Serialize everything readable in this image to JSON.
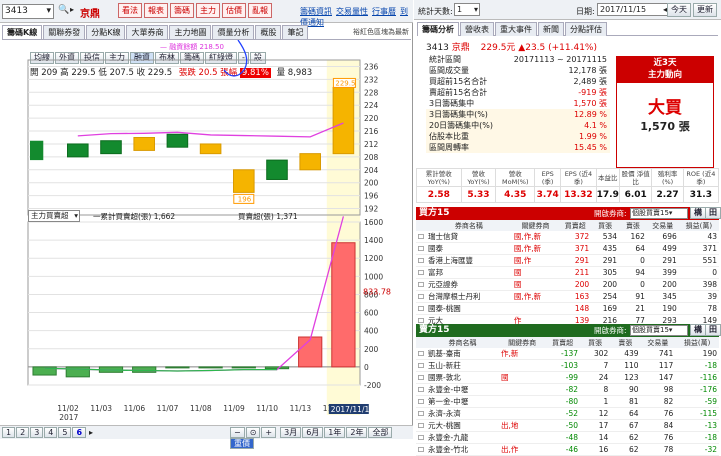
{
  "top": {
    "code": "3413",
    "name": "京鼎",
    "nav": [
      "看法",
      "報表",
      "籌碼",
      "主力",
      "估價",
      "亂報"
    ],
    "links": [
      "籌碼資訊",
      "交易量性",
      "行事曆",
      "到價通知"
    ]
  },
  "left": {
    "tabs": [
      "籌碼K線",
      "關聯券發",
      "分點K線",
      "大單券商",
      "主力地圖",
      "價量分析",
      "概股",
      "筆記"
    ],
    "right_note": "裕紅色區塊為最新",
    "subtabs": [
      "均線",
      "外資",
      "投信",
      "主力",
      "融資",
      "布林",
      "籌碼",
      "紅綠燈",
      "-",
      "設"
    ],
    "subtab_active": "融資",
    "legend": "— 融資餘額 218.50",
    "ohlc": "開 209 高 229.5 低 207.5 收 229.5",
    "chg_label": "張跌 20.5 張幅",
    "chg_pct": "9.81%",
    "vol": "量 8,983",
    "price_ticks": [
      "236",
      "232",
      "228",
      "224",
      "220",
      "216",
      "212",
      "208",
      "204",
      "200",
      "196",
      "192"
    ],
    "high_tag": "229.5",
    "low_tag": "196",
    "vol_ticks": [
      "1600",
      "1400",
      "1200",
      "1000",
      "800",
      "600",
      "400",
      "200",
      "0",
      "-200"
    ],
    "vol_current": "833.78",
    "select": "主力買賣超",
    "l1": "一累計買賣超(張) 1,662",
    "l2": "買賣超(張) 1,371",
    "dates": [
      "11/02",
      "11/03",
      "11/06",
      "11/07",
      "11/08",
      "11/09",
      "11/10",
      "11/13",
      "11/14"
    ],
    "year": "2017",
    "cur_date": "2017/11/15",
    "pages": [
      "1",
      "2",
      "3",
      "4",
      "5",
      "6"
    ],
    "zoom": [
      "3月",
      "6月",
      "1年",
      "2年",
      "全部",
      "重價"
    ],
    "candles": [
      {
        "o": 212,
        "c": 208,
        "up": false
      },
      {
        "o": 213,
        "c": 209,
        "up": false
      },
      {
        "o": 210,
        "c": 214,
        "up": true
      },
      {
        "o": 215,
        "c": 211,
        "up": false
      },
      {
        "o": 209,
        "c": 212,
        "up": true
      },
      {
        "o": 204,
        "c": 197,
        "up": true
      },
      {
        "o": 201,
        "c": 207,
        "up": false
      },
      {
        "o": 204,
        "c": 209,
        "up": true
      },
      {
        "o": 209,
        "c": 229.5,
        "up": true
      }
    ],
    "ma": [
      214.5,
      215.2,
      215.3,
      215.6,
      214.8,
      214.6,
      214.4,
      214.2,
      218.5
    ],
    "vol_bars": [
      -90,
      -110,
      -60,
      -60,
      -10,
      -10,
      -5,
      -20,
      330,
      1371
    ],
    "cum": [
      -15,
      -25,
      -35,
      -40,
      -45,
      -40,
      -30,
      -30,
      300,
      1662
    ]
  },
  "right": {
    "top_label": "統計天數:",
    "days": "1",
    "date_label": "日期:",
    "date": "2017/11/15",
    "today_btn": "今天",
    "refresh_btn": "更新",
    "tabs": [
      "籌碼分析",
      "營收表",
      "重大事件",
      "新聞",
      "分點評估"
    ],
    "title_code": "3413",
    "title_name": "京鼎",
    "title_price": "229.5元 ▲23.5 (+11.41%)",
    "stats": [
      [
        "統計區間",
        "20171113 ~ 20171115"
      ],
      [
        "區間成交量",
        "12,178 張"
      ],
      [
        "買超前15名合計",
        "2,489 張"
      ],
      [
        "賣超前15名合計",
        "-919 張"
      ],
      [
        "3日籌碼集中",
        "1,570 張"
      ],
      [
        "3日籌碼集中(%)",
        "12.89 %"
      ],
      [
        "20日籌碼集中(%)",
        "4.1 %"
      ],
      [
        "佔股本比重",
        "1.99 %"
      ],
      [
        "區間周轉率",
        "15.45 %"
      ]
    ],
    "box_red": [
      "近3天",
      "主力動向"
    ],
    "big": "大買",
    "big_val": "1,570 張",
    "fin_heads": [
      "累計營收 YoY(%)",
      "營收 YoY(%)",
      "營收 MoM(%)",
      "EPS (季)",
      "EPS (近4季)",
      "本益比",
      "股價 淨值比",
      "殖利率 (%)",
      "ROE (近4季)"
    ],
    "fin_vals": [
      "2.58",
      "5.33",
      "4.35",
      "3.74",
      "13.32",
      "17.9",
      "6.01",
      "2.27",
      "31.3"
    ],
    "buy_title": "買方15",
    "sell_title": "賣方15",
    "sel_label": "開啟券商:",
    "sel": "個股買賣15",
    "btns": [
      "構",
      "田"
    ],
    "col": [
      "券商名稱",
      "關鍵券商",
      "買賣超",
      "買張",
      "賣張",
      "交易量",
      "損益(萬)"
    ],
    "buy": [
      [
        "瑞士信貸",
        "國,作,新",
        "372",
        "534",
        "162",
        "696",
        "43"
      ],
      [
        "國泰",
        "國,作,新",
        "371",
        "435",
        "64",
        "499",
        "371"
      ],
      [
        "香港上海匯豐",
        "國,作",
        "291",
        "291",
        "0",
        "291",
        "551"
      ],
      [
        "富邦",
        "國",
        "211",
        "305",
        "94",
        "399",
        "0"
      ],
      [
        "元亞證券",
        "國",
        "200",
        "200",
        "0",
        "200",
        "398"
      ],
      [
        "台灣摩根士丹利",
        "國,作,新",
        "163",
        "254",
        "91",
        "345",
        "39"
      ],
      [
        "國泰-桃園",
        "",
        "148",
        "169",
        "21",
        "190",
        "78"
      ],
      [
        "元大",
        "作",
        "139",
        "216",
        "77",
        "293",
        "149"
      ],
      [
        "凱基",
        "國,作",
        "105",
        "408",
        "303",
        "711",
        "0"
      ]
    ],
    "sell": [
      [
        "凱基-臺南",
        "作,新",
        "-137",
        "302",
        "439",
        "741",
        "190"
      ],
      [
        "玉山-新莊",
        "",
        "-103",
        "7",
        "110",
        "117",
        "-18"
      ],
      [
        "國票-敦北",
        "國",
        "-99",
        "24",
        "123",
        "147",
        "-116"
      ],
      [
        "永豐金-中壢",
        "",
        "-82",
        "8",
        "90",
        "98",
        "-176"
      ],
      [
        "第一金-中壢",
        "",
        "-80",
        "1",
        "81",
        "82",
        "-59"
      ],
      [
        "永濟-永濟",
        "",
        "-52",
        "12",
        "64",
        "76",
        "-115"
      ],
      [
        "元大-桃園",
        "出,地",
        "-50",
        "17",
        "67",
        "84",
        "-13"
      ],
      [
        "永豐金-九龍",
        "",
        "-48",
        "14",
        "62",
        "76",
        "-18"
      ],
      [
        "永豐金-竹北",
        "出,作",
        "-46",
        "16",
        "62",
        "78",
        "-32"
      ]
    ]
  }
}
